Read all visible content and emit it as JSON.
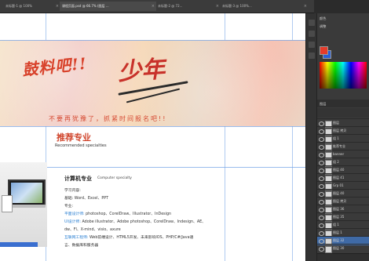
{
  "tabs": [
    {
      "label": "未标题-1 @ 100%",
      "active": false
    },
    {
      "label": "课程页面.psd @ 66.7% (图层 ...",
      "active": true
    },
    {
      "label": "未标题-2 @ 72...",
      "active": false
    },
    {
      "label": "未标题-3 @ 100%...",
      "active": false
    }
  ],
  "banner": {
    "title_left": "鼓料吧!!",
    "title_right": "少年",
    "subtitle": "不要再犹豫了，抓紧时间报名吧!!"
  },
  "section": {
    "title": "推荐专业",
    "subtitle": "Recommended specialties"
  },
  "course": {
    "name": "计算机专业",
    "name_en": "Computer specialty",
    "lines": [
      {
        "label": "学习内容:",
        "highlight": ""
      },
      {
        "label": "基础: Word、Excel、PPT",
        "highlight": ""
      },
      {
        "label": "专业:",
        "highlight": ""
      },
      {
        "label": "photoshop、CorelDraw、Illustrator、InDesign",
        "highlight": "平面设计师:"
      },
      {
        "label": "Adobe illustrator、Adobe photoshop、CorelDraw、Indesign、AE、",
        "highlight": "UI设计师:"
      },
      {
        "label": "dw、Fl、X-mind、visio、axure",
        "highlight": ""
      },
      {
        "label": "Web前端设计、HTML5开发、未来影响IOS、PHP/C#/Java语",
        "highlight": "互联网工程师:"
      },
      {
        "label": "言、数据库和服务器",
        "highlight": ""
      }
    ]
  },
  "panel": {
    "title_color": "颜色",
    "title_adjust": "调整",
    "title_layers": "图层",
    "colors": {
      "foreground": "#e53b2a",
      "background": "#2a5fd8"
    },
    "layers": [
      {
        "name": "图层",
        "selected": false
      },
      {
        "name": "图层 拷贝",
        "selected": false
      },
      {
        "name": "组 1",
        "selected": false
      },
      {
        "name": "推荐专业",
        "selected": false
      },
      {
        "name": "banner",
        "selected": false
      },
      {
        "name": "组 2",
        "selected": false
      },
      {
        "name": "图层 40",
        "selected": false
      },
      {
        "name": "图层 41",
        "selected": false
      },
      {
        "name": "Grp 01",
        "selected": false
      },
      {
        "name": "图层 40",
        "selected": false
      },
      {
        "name": "图层 拷贝",
        "selected": false
      },
      {
        "name": "图层 36",
        "selected": false
      },
      {
        "name": "图层 35",
        "selected": false
      },
      {
        "name": "组 1",
        "selected": false
      },
      {
        "name": "图层 1",
        "selected": false
      },
      {
        "name": "图层 32",
        "selected": true
      },
      {
        "name": "图层 30",
        "selected": false
      }
    ]
  }
}
